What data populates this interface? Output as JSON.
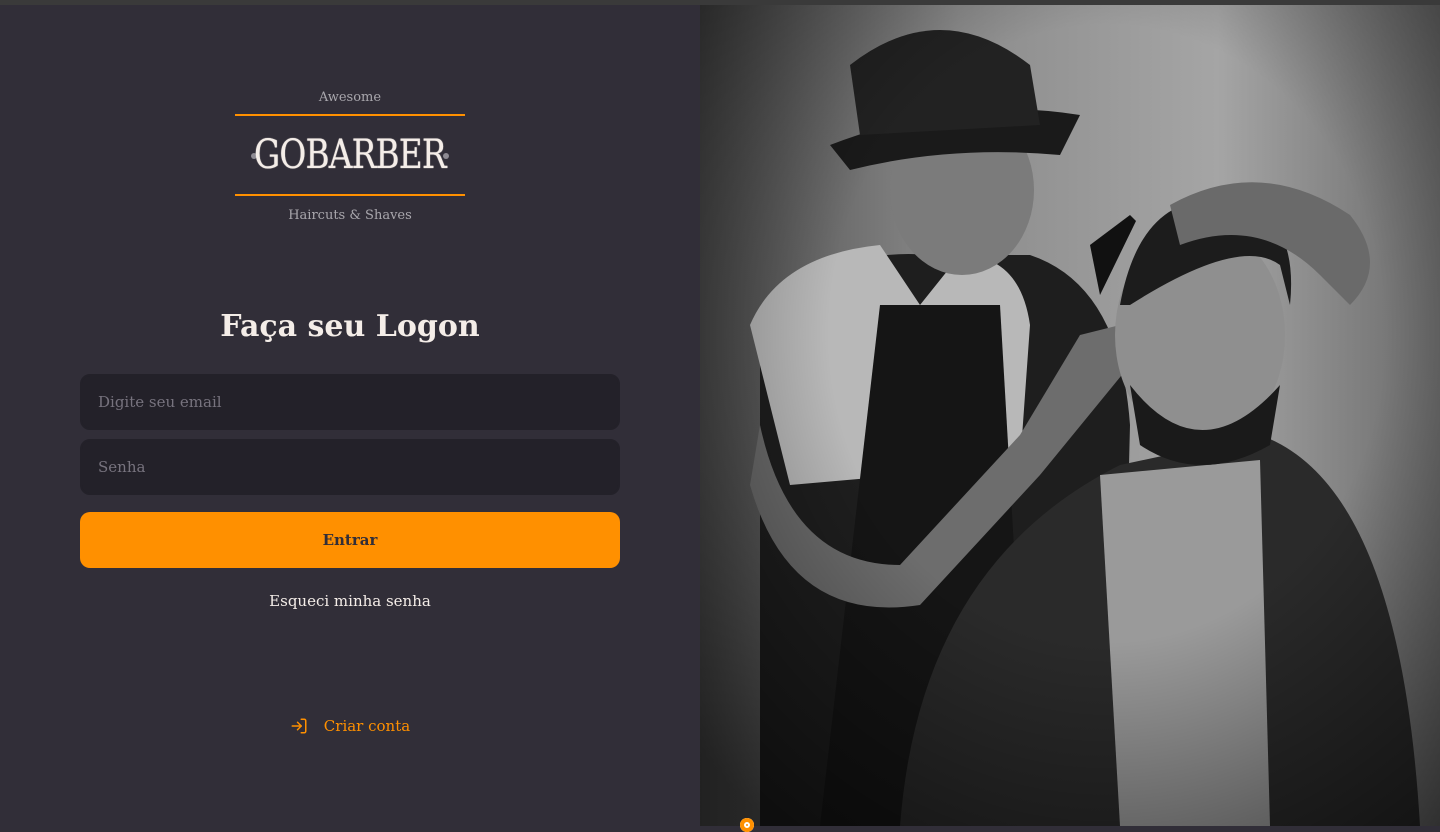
{
  "logo": {
    "tagline_top": "Awesome",
    "brand": "GOBARBER",
    "tagline_bottom": "Haircuts & Shaves"
  },
  "form": {
    "title": "Faça seu Logon",
    "email_placeholder": "Digite seu email",
    "email_value": "",
    "password_placeholder": "Senha",
    "password_value": "",
    "submit_label": "Entrar",
    "forgot_label": "Esqueci minha senha"
  },
  "footer": {
    "create_account_label": "Criar conta",
    "create_account_icon": "log-in-icon"
  },
  "hero": {
    "image_icon": "barber-photo"
  },
  "colors": {
    "background": "#312e38",
    "input": "#232129",
    "accent": "#ff9000",
    "text": "#f4ede8",
    "muted": "#a9a7ad",
    "placeholder": "#77737e"
  }
}
